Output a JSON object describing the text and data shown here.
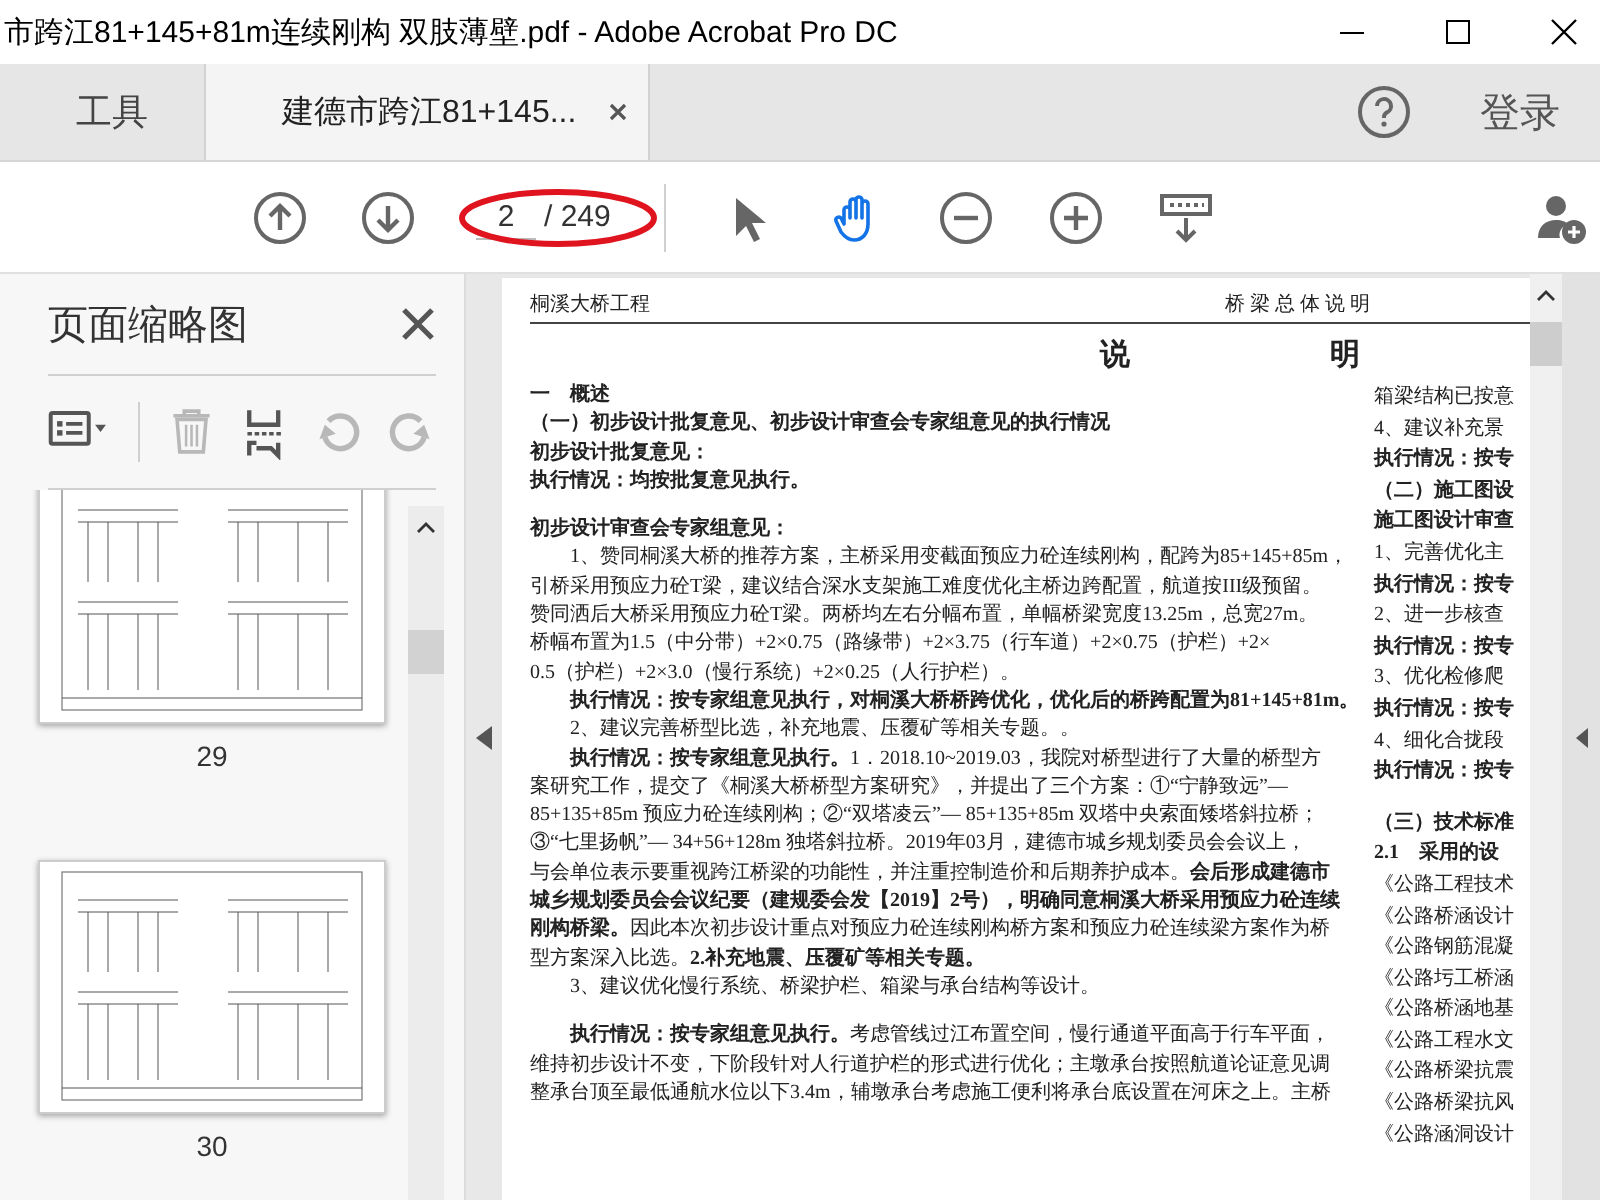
{
  "window": {
    "title": "市跨江81+145+81m连续刚构 双肢薄壁.pdf - Adobe Acrobat Pro DC"
  },
  "tabs": [
    {
      "label": "工具",
      "selected": false,
      "closable": false
    },
    {
      "label": "建德市跨江81+145...",
      "selected": true,
      "closable": true
    }
  ],
  "account": {
    "label": "登录"
  },
  "toolbar": {
    "page_field": {
      "value": "2"
    },
    "page_total": "/ 249",
    "page_highlighted": true,
    "nav": [
      {
        "kind": "up"
      },
      {
        "kind": "down"
      }
    ],
    "tools": [
      {
        "kind": "select",
        "selected": false
      },
      {
        "kind": "hand",
        "selected": true
      },
      {
        "kind": "zoom-out",
        "selected": false
      },
      {
        "kind": "zoom-in",
        "selected": false
      },
      {
        "kind": "scroll-mode",
        "selected": false
      },
      {
        "kind": "add-user",
        "selected": false
      }
    ]
  },
  "sidebar": {
    "title": "页面缩略图",
    "tools": [
      {
        "kind": "options",
        "disabled": false
      },
      {
        "kind": "delete",
        "disabled": true
      },
      {
        "kind": "extract",
        "disabled": false
      },
      {
        "kind": "rotate-left",
        "disabled": true
      },
      {
        "kind": "rotate-right",
        "disabled": true
      }
    ],
    "thumbnails": [
      {
        "label": "29"
      },
      {
        "label": "30"
      }
    ]
  },
  "document": {
    "header_left": "桐溪大桥工程",
    "header_right": "桥 梁 总 体 说 明",
    "title": [
      "说",
      "明"
    ],
    "left_column": [
      [
        {
          "text": "一　概述",
          "bold": true
        },
        {
          "text": "（一）初步设计批复意见、初步设计审查会专家组意见的执行情况",
          "bold": true
        },
        {
          "text": "初步设计批复意见：",
          "bold": true
        },
        {
          "text": "执行情况：均按批复意见执行。",
          "bold": true
        }
      ],
      [
        {
          "text": "初步设计审查会专家组意见：",
          "bold": true
        },
        {
          "text": "　　1、赞同桐溪大桥的推荐方案，主桥采用变截面预应力砼连续刚构，配跨为85+145+85m，",
          "bold": false
        },
        {
          "text": "引桥采用预应力砼T梁，建议结合深水支架施工难度优化主桥边跨配置，航道按III级预留。",
          "bold": false
        },
        {
          "text": "赞同洒后大桥采用预应力砼T梁。两桥均左右分幅布置，单幅桥梁宽度13.25m，总宽27m。",
          "bold": false
        },
        {
          "text": "桥幅布置为1.5（中分带）+2×0.75（路缘带）+2×3.75（行车道）+2×0.75（护栏）+2×",
          "bold": false
        },
        {
          "text": "0.5（护栏）+2×3.0（慢行系统）+2×0.25（人行护栏）。",
          "bold": false
        },
        {
          "text": "　　执行情况：按专家组意见执行，对桐溪大桥桥跨优化，优化后的桥跨配置为81+145+81m。",
          "bold": true
        },
        {
          "text": "　　2、建议完善桥型比选，补充地震、压覆矿等相关专题。。",
          "bold": false
        },
        {
          "text": "　　**执行情况：按专家组意见执行。**1．2018.10~2019.03，我院对桥型进行了大量的桥型方",
          "bold": false
        },
        {
          "text": "案研究工作，提交了《桐溪大桥桥型方案研究》，并提出了三个方案：①“宁静致远”—",
          "bold": false
        },
        {
          "text": "85+135+85m 预应力砼连续刚构；②“双塔凌云”— 85+135+85m 双塔中央索面矮塔斜拉桥；",
          "bold": false
        },
        {
          "text": "③“七里扬帆”— 34+56+128m 独塔斜拉桥。2019年03月，建德市城乡规划委员会会议上，",
          "bold": false
        },
        {
          "text": "与会单位表示要重视跨江桥梁的功能性，并注重控制造价和后期养护成本。**会后形成建德市**",
          "bold": false
        },
        {
          "text": "城乡规划委员会会议纪要（建规委会发【2019】2号），明确同意桐溪大桥采用预应力砼连续",
          "bold": true
        },
        {
          "text": "**刚构桥梁。**因此本次初步设计重点对预应力砼连续刚构桥方案和预应力砼连续梁方案作为桥",
          "bold": false
        },
        {
          "text": "型方案深入比选。**2.补充地震、压覆矿等相关专题。**",
          "bold": false
        },
        {
          "text": "　　3、建议优化慢行系统、桥梁护栏、箱梁与承台结构等设计。",
          "bold": false
        }
      ],
      [
        {
          "text": "　　**执行情况：按专家组意见执行。**考虑管线过江布置空间，慢行通道平面高于行车平面，",
          "bold": false
        },
        {
          "text": "维持初步设计不变，下阶段针对人行道护栏的形式进行优化；主墩承台按照航道论证意见调",
          "bold": false
        },
        {
          "text": "整承台顶至最低通航水位以下3.4m，辅墩承台考虑施工便利将承台底设置在河床之上。主桥",
          "bold": false
        }
      ]
    ],
    "right_column": [
      [
        {
          "text": "箱梁结构已按意",
          "bold": false
        },
        {
          "text": "4、建议补充景",
          "bold": false
        },
        {
          "text": "执行情况：按专",
          "bold": true
        },
        {
          "text": "（二）施工图设",
          "bold": true
        },
        {
          "text": "施工图设计审查",
          "bold": true
        },
        {
          "text": "1、完善优化主",
          "bold": false
        },
        {
          "text": "执行情况：按专",
          "bold": true
        },
        {
          "text": "2、进一步核查",
          "bold": false
        },
        {
          "text": "执行情况：按专",
          "bold": true
        },
        {
          "text": "3、优化检修爬",
          "bold": false
        },
        {
          "text": "执行情况：按专",
          "bold": true
        },
        {
          "text": "4、细化合拢段",
          "bold": false
        },
        {
          "text": "执行情况：按专",
          "bold": true
        }
      ],
      [
        {
          "text": "（三）技术标准",
          "bold": true
        },
        {
          "text": "2.1　采用的设",
          "bold": true
        },
        {
          "text": "《公路工程技术",
          "bold": false
        },
        {
          "text": "《公路桥涵设计",
          "bold": false
        },
        {
          "text": "《公路钢筋混凝",
          "bold": false
        },
        {
          "text": "《公路圬工桥涵",
          "bold": false
        },
        {
          "text": "《公路桥涵地基",
          "bold": false
        },
        {
          "text": "《公路工程水文",
          "bold": false
        },
        {
          "text": "《公路桥梁抗震",
          "bold": false
        },
        {
          "text": "《公路桥梁抗风",
          "bold": false
        },
        {
          "text": "《公路涵洞设计",
          "bold": false
        }
      ]
    ]
  }
}
